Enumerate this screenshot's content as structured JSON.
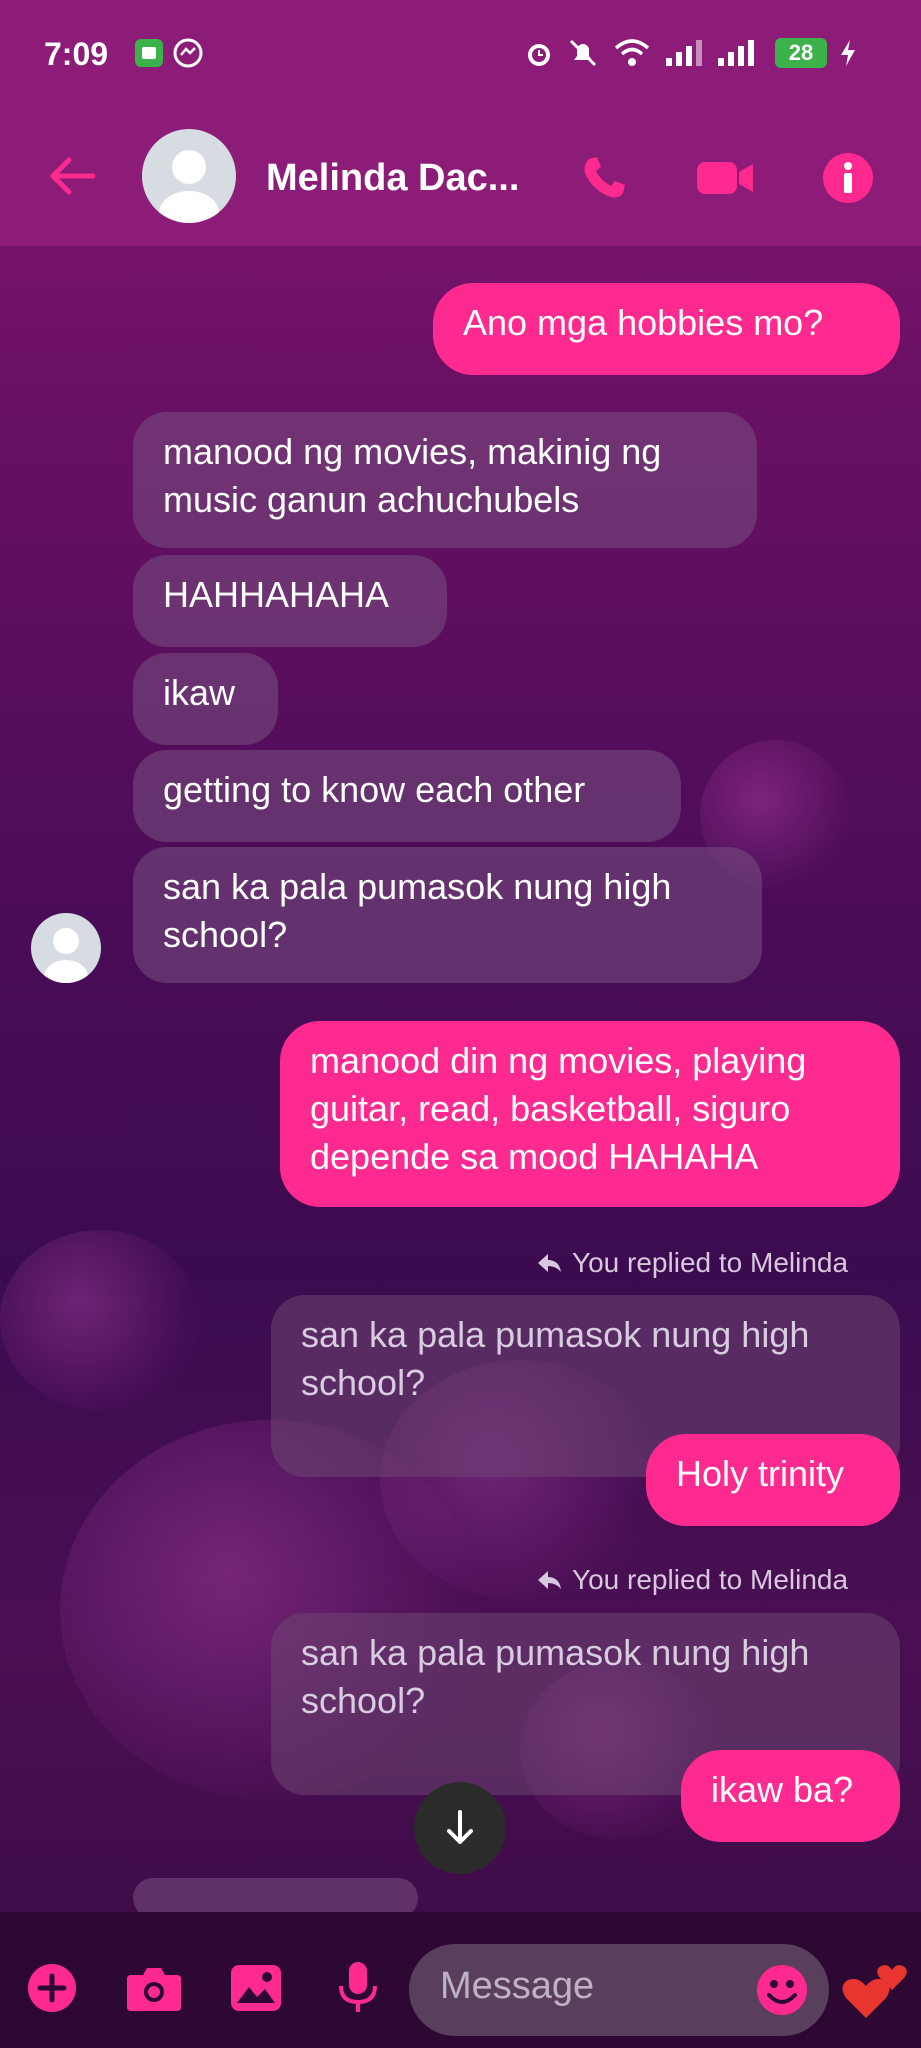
{
  "status_bar": {
    "time": "7:09",
    "battery": "28"
  },
  "header": {
    "contact_name": "Melinda Dac...",
    "back_icon": "arrow-left-icon",
    "call_icon": "phone-icon",
    "video_icon": "video-icon",
    "info_icon": "info-icon"
  },
  "messages": {
    "m1": "Ano mga hobbies mo?",
    "m2": "manood ng movies, makinig ng music ganun achuchubels",
    "m3": "HAHHAHAHA",
    "m4": "ikaw",
    "m5": "getting to know each other",
    "m6": "san ka pala pumasok nung high school?",
    "m7": "manood din ng movies, playing guitar, read, basketball, siguro depende sa mood HAHAHA",
    "reply1_label": "You replied to Melinda",
    "reply1_quote": "san ka pala pumasok nung high school?",
    "reply1_text": "Holy trinity",
    "reply2_label": "You replied to Melinda",
    "reply2_quote": "san ka pala pumasok nung high school?",
    "reply2_text": "ikaw ba?"
  },
  "composer": {
    "placeholder": "Message"
  },
  "colors": {
    "accent": "#ff2a8f",
    "header_bg": "#8c1c77"
  }
}
